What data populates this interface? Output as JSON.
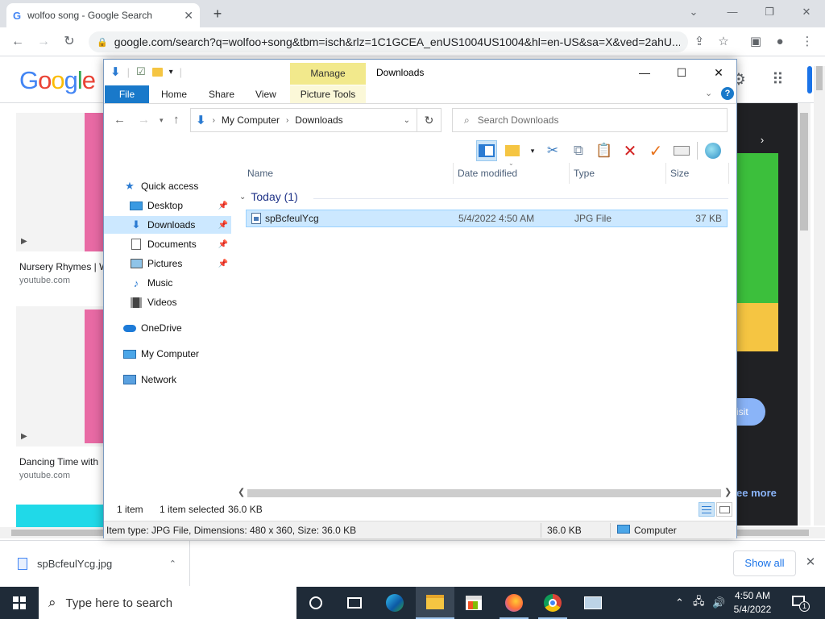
{
  "browser": {
    "tab_title": "wolfoo song - Google Search",
    "tab_favicon": "G",
    "url": "google.com/search?q=wolfoo+song&tbm=isch&rlz=1C1GCEA_enUS1004US1004&hl=en-US&sa=X&ved=2ahU..."
  },
  "google": {
    "logo_letters": [
      "G",
      "o",
      "o",
      "g",
      "l",
      "e"
    ],
    "results": [
      {
        "title": "Nursery Rhymes | W",
        "source": "youtube.com"
      },
      {
        "title": "Dancing Time with",
        "source": "youtube.com"
      }
    ],
    "visit_label": "isit",
    "see_more": "ee more"
  },
  "explorer": {
    "manage_label": "Manage",
    "window_title": "Downloads",
    "ribbon_tabs": {
      "file": "File",
      "home": "Home",
      "share": "Share",
      "view": "View",
      "picture_tools": "Picture Tools"
    },
    "address": {
      "root": "My Computer",
      "current": "Downloads"
    },
    "search_placeholder": "Search Downloads",
    "nav": {
      "quick_access": "Quick access",
      "desktop": "Desktop",
      "downloads": "Downloads",
      "documents": "Documents",
      "pictures": "Pictures",
      "music": "Music",
      "videos": "Videos",
      "onedrive": "OneDrive",
      "my_computer": "My Computer",
      "network": "Network"
    },
    "columns": {
      "name": "Name",
      "date": "Date modified",
      "type": "Type",
      "size": "Size"
    },
    "group_label": "Today (1)",
    "files": [
      {
        "name": "spBcfeulYcg",
        "date": "5/4/2022 4:50 AM",
        "type": "JPG File",
        "size": "37 KB"
      }
    ],
    "status": {
      "count": "1 item",
      "selected": "1 item selected",
      "selected_size": "36.0 KB"
    },
    "details": {
      "info": "Item type: JPG File, Dimensions: 480 x 360, Size: 36.0 KB",
      "size": "36.0 KB",
      "location": "Computer"
    }
  },
  "downloads_bar": {
    "file": "spBcfeulYcg.jpg",
    "show_all": "Show all"
  },
  "taskbar": {
    "search_placeholder": "Type here to search",
    "time": "4:50 AM",
    "date": "5/4/2022",
    "notification_count": "1"
  }
}
